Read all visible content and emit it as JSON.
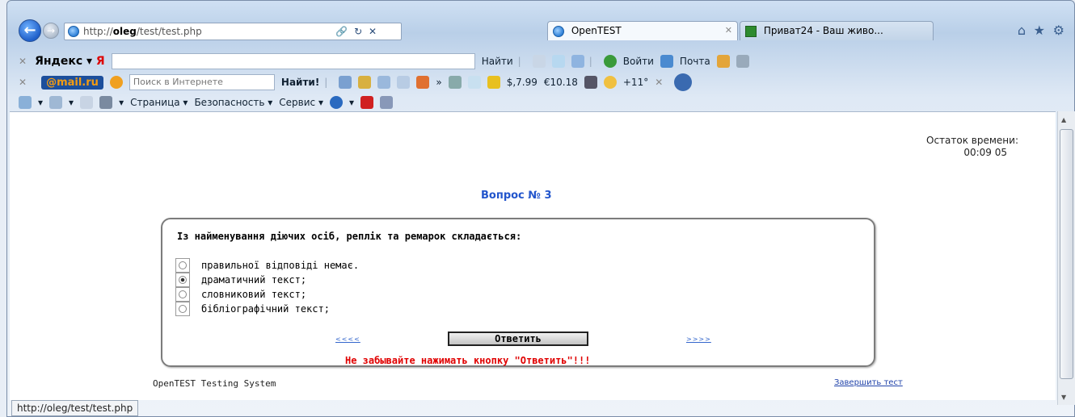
{
  "browser": {
    "address_url_prefix": "http://",
    "address_url_host": "oleg",
    "address_url_path": "/test/test.php",
    "address_tools": "🔗 ↻ ✕",
    "tabs": [
      {
        "label": "OpenTEST"
      },
      {
        "label": "Приват24 - Ваш живо..."
      }
    ]
  },
  "yandex_bar": {
    "logo": "Яндекс",
    "logo_mark": "Я",
    "find_label": "Найти",
    "login_label": "Войти",
    "mail_label": "Почта"
  },
  "mailru_bar": {
    "logo_main": "@mail",
    "logo_suffix": ".ru",
    "search_placeholder": "Поиск в Интернете",
    "find_label": "Найти!",
    "usd": "$",
    "usd_value": "7.99",
    "eur": "€",
    "eur_value": "10.18",
    "weather": "+11°"
  },
  "command_bar": {
    "page_label": "Страница",
    "security_label": "Безопасность",
    "service_label": "Сервис"
  },
  "page": {
    "timer_label": "Остаток времени:",
    "timer_value": "00:09 05",
    "question_number": "Вопрос № 3",
    "question_text": "Із найменування діючих осіб, реплік та ремарок складається:",
    "options": [
      {
        "label": "правильної відповіді немає.",
        "checked": false
      },
      {
        "label": "драматичний текст;",
        "checked": true
      },
      {
        "label": "словниковий текст;",
        "checked": false
      },
      {
        "label": "бібліографічний текст;",
        "checked": false
      }
    ],
    "prev_link": "<<<<",
    "next_link": ">>>>",
    "answer_button": "Ответить",
    "reminder": "Не забывайте нажимать кнопку \"Ответить\"!!!",
    "footer_brand": "OpenTEST Testing System",
    "finish_link": "Завершить тест"
  },
  "status_bar": {
    "url": "http://oleg/test/test.php"
  }
}
